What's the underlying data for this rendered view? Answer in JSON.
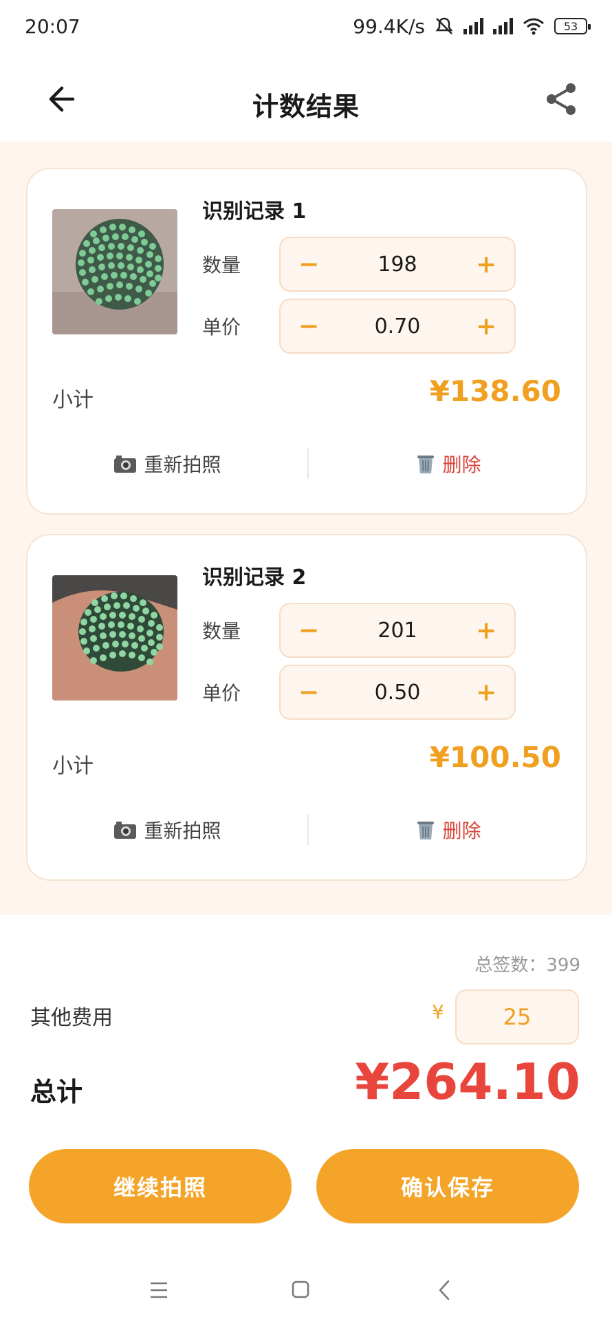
{
  "status_bar": {
    "time": "20:07",
    "speed": "99.4K/s",
    "battery": "53",
    "icons": [
      "mute-icon",
      "signal-icon",
      "signal-icon",
      "wifi-icon",
      "battery-icon"
    ]
  },
  "header": {
    "title": "计数结果",
    "back_icon": "arrow-left-icon",
    "share_icon": "share-icon"
  },
  "records": [
    {
      "title": "识别记录 1",
      "quantity_label": "数量",
      "quantity": "198",
      "price_label": "单价",
      "price": "0.70",
      "subtotal_label": "小计",
      "subtotal": "¥138.60",
      "retake_label": "重新拍照",
      "delete_label": "删除",
      "minus": "−",
      "plus": "+"
    },
    {
      "title": "识别记录 2",
      "quantity_label": "数量",
      "quantity": "201",
      "price_label": "单价",
      "price": "0.50",
      "subtotal_label": "小计",
      "subtotal": "¥100.50",
      "retake_label": "重新拍照",
      "delete_label": "删除",
      "minus": "−",
      "plus": "+"
    }
  ],
  "summary": {
    "total_count": "总签数：399",
    "other_fee_label": "其他费用",
    "currency": "¥",
    "other_fee": "25",
    "grand_total_label": "总计",
    "grand_total": "¥264.10"
  },
  "buttons": {
    "continue": "继续拍照",
    "save": "确认保存"
  },
  "colors": {
    "accent": "#f4a428",
    "total_red": "#e8453c",
    "delete_red": "#d9453a",
    "list_bg": "#fdf5ee"
  }
}
